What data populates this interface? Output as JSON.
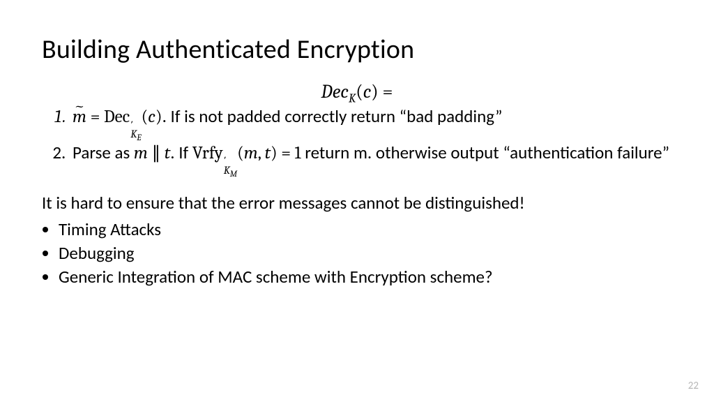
{
  "title": "Building Authenticated Encryption",
  "equation": "𝐷𝑒𝑐_K(𝑐) =",
  "step1_tail": ". If is not padded correctly return “bad padding”",
  "step2_pre": "Parse as ",
  "step2_mid": ". If ",
  "step2_tail": " return m. otherwise output “authentication failure”",
  "note": "It is hard to ensure that the error messages cannot be distinguished!",
  "bullets": [
    "Timing Attacks",
    "Debugging",
    "Generic Integration of MAC scheme with Encryption scheme?"
  ],
  "page_number": "22"
}
